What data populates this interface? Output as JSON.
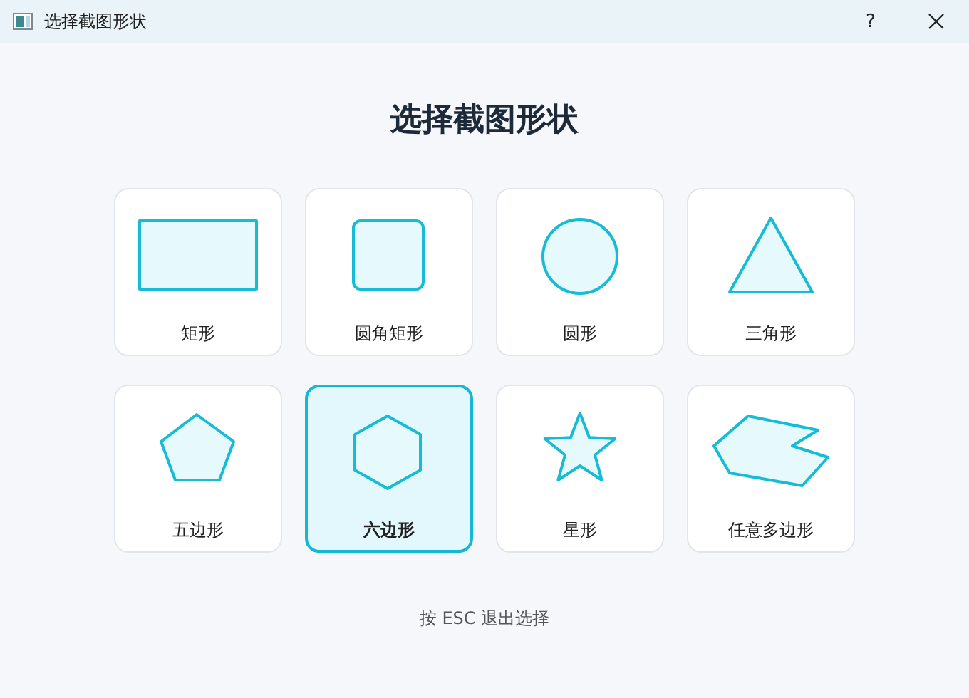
{
  "window": {
    "title": "选择截图形状",
    "help": "?"
  },
  "heading": "选择截图形状",
  "shapes": [
    {
      "kind": "rectangle",
      "label": "矩形",
      "selected": false
    },
    {
      "kind": "rounded",
      "label": "圆角矩形",
      "selected": false
    },
    {
      "kind": "circle",
      "label": "圆形",
      "selected": false
    },
    {
      "kind": "triangle",
      "label": "三角形",
      "selected": false
    },
    {
      "kind": "pentagon",
      "label": "五边形",
      "selected": false
    },
    {
      "kind": "hexagon",
      "label": "六边形",
      "selected": true
    },
    {
      "kind": "star",
      "label": "星形",
      "selected": false
    },
    {
      "kind": "freeform",
      "label": "任意多边形",
      "selected": false
    }
  ],
  "hint": "按 ESC 退出选择"
}
